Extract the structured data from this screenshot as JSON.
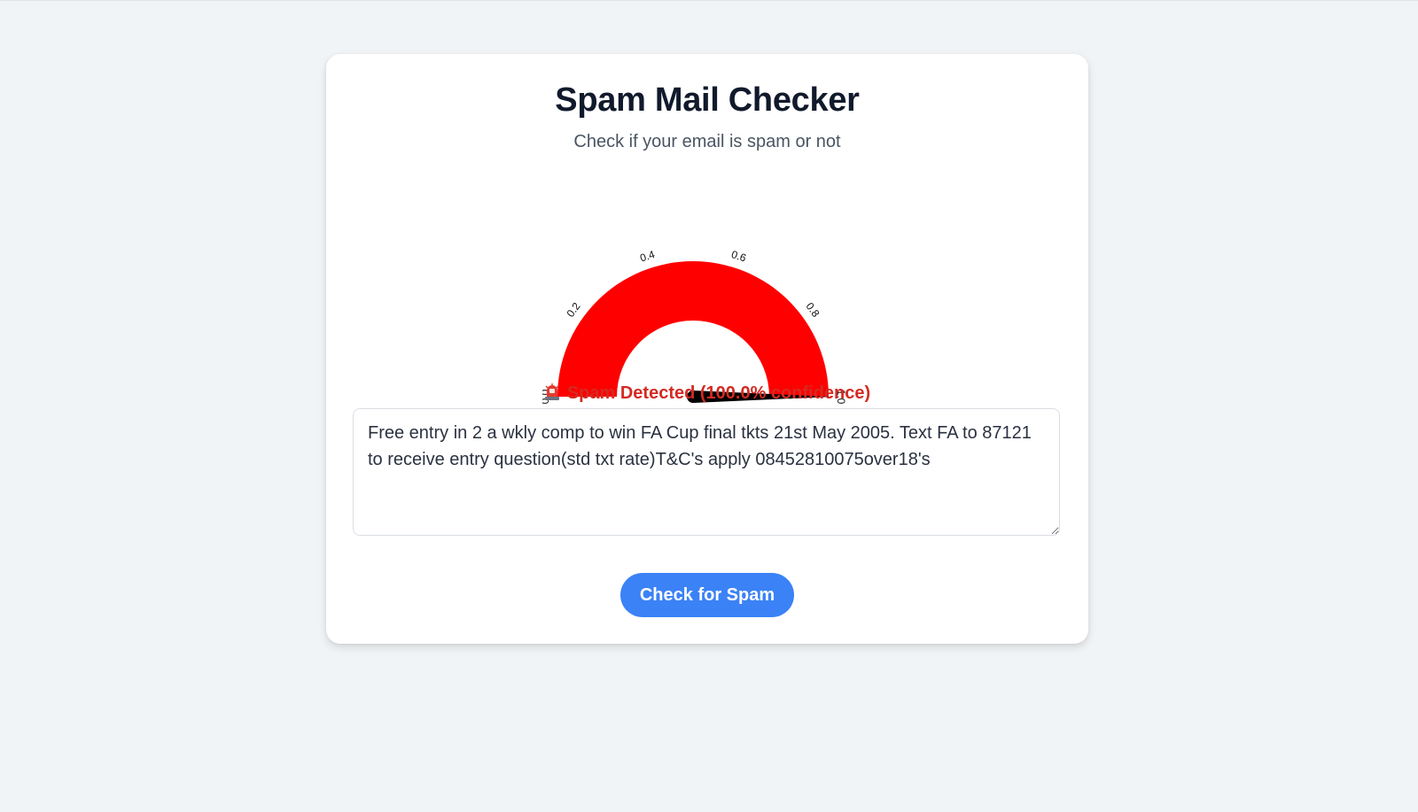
{
  "app": {
    "title": "Spam Mail Checker",
    "subtitle": "Check if your email is spam or not"
  },
  "gauge": {
    "value": 1.0,
    "range": [
      0,
      1
    ],
    "tick_labels": [
      "0.0",
      "0.2",
      "0.4",
      "0.6",
      "0.8",
      "1.0"
    ],
    "bar_color": "#ff0000",
    "needle_color": "#000000"
  },
  "result": {
    "icon": "rotating-light-icon",
    "text": "Spam Detected (100.0% confidence)",
    "color": "#d32a22"
  },
  "email_input": {
    "value": "Free entry in 2 a wkly comp to win FA Cup final tkts 21st May 2005. Text FA to 87121 to receive entry question(std txt rate)T&C's apply 08452810075over18's"
  },
  "check_button": {
    "label": "Check for Spam",
    "color": "#3b82f6"
  }
}
